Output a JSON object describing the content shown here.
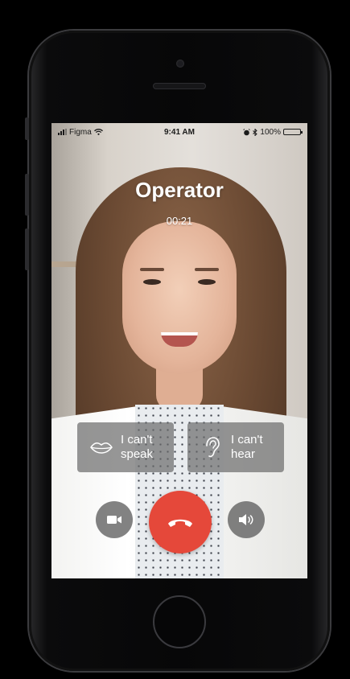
{
  "status_bar": {
    "carrier": "Figma",
    "time": "9:41 AM",
    "battery": "100%",
    "signal_icon": "signal-bars-icon",
    "wifi_icon": "wifi-icon",
    "bluetooth_icon": "bluetooth-icon",
    "alarm_icon": "alarm-icon"
  },
  "call": {
    "caller_name": "Operator",
    "duration": "00:21"
  },
  "accessibility_buttons": [
    {
      "label_line1": "I can't",
      "label_line2": "speak",
      "icon": "lips-icon"
    },
    {
      "label_line1": "I can't",
      "label_line2": "hear",
      "icon": "ear-icon"
    }
  ],
  "controls": {
    "video_icon": "video-camera-icon",
    "end_call_icon": "hang-up-icon",
    "speaker_icon": "speaker-icon",
    "end_call_color": "#e5483a"
  }
}
